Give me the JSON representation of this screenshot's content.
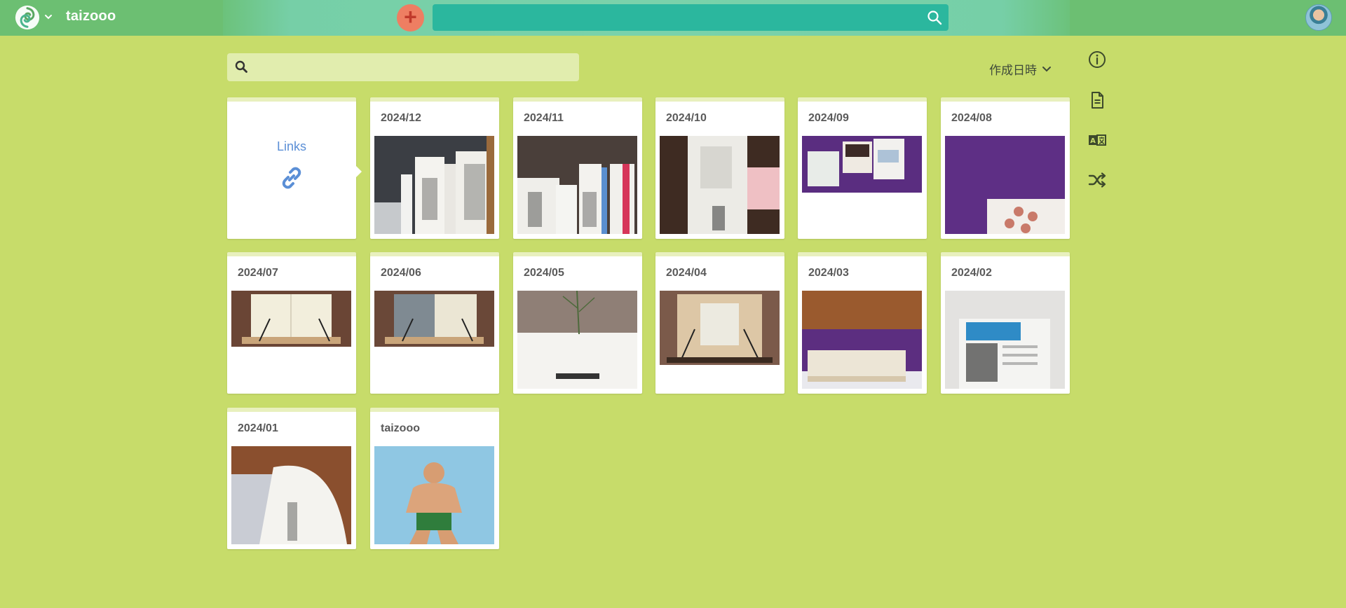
{
  "header": {
    "brand": "taizooo",
    "search_placeholder": ""
  },
  "filter": {
    "placeholder": "",
    "sort_label": "作成日時"
  },
  "colors": {
    "background": "#c7dc6a",
    "topbar": "#6cbf72",
    "accent_search": "#2bb79e",
    "add_button": "#ee7e62",
    "link_blue": "#5b8fd6"
  },
  "rail_icons": [
    "info-icon",
    "document-icon",
    "translate-icon",
    "shuffle-icon"
  ],
  "cards": {
    "links": {
      "label": "Links"
    },
    "items": [
      {
        "title": "2024/12"
      },
      {
        "title": "2024/11"
      },
      {
        "title": "2024/10"
      },
      {
        "title": "2024/09"
      },
      {
        "title": "2024/08"
      },
      {
        "title": "2024/07"
      },
      {
        "title": "2024/06"
      },
      {
        "title": "2024/05"
      },
      {
        "title": "2024/04"
      },
      {
        "title": "2024/03"
      },
      {
        "title": "2024/02"
      },
      {
        "title": "2024/01"
      },
      {
        "title": "taizooo"
      }
    ]
  }
}
